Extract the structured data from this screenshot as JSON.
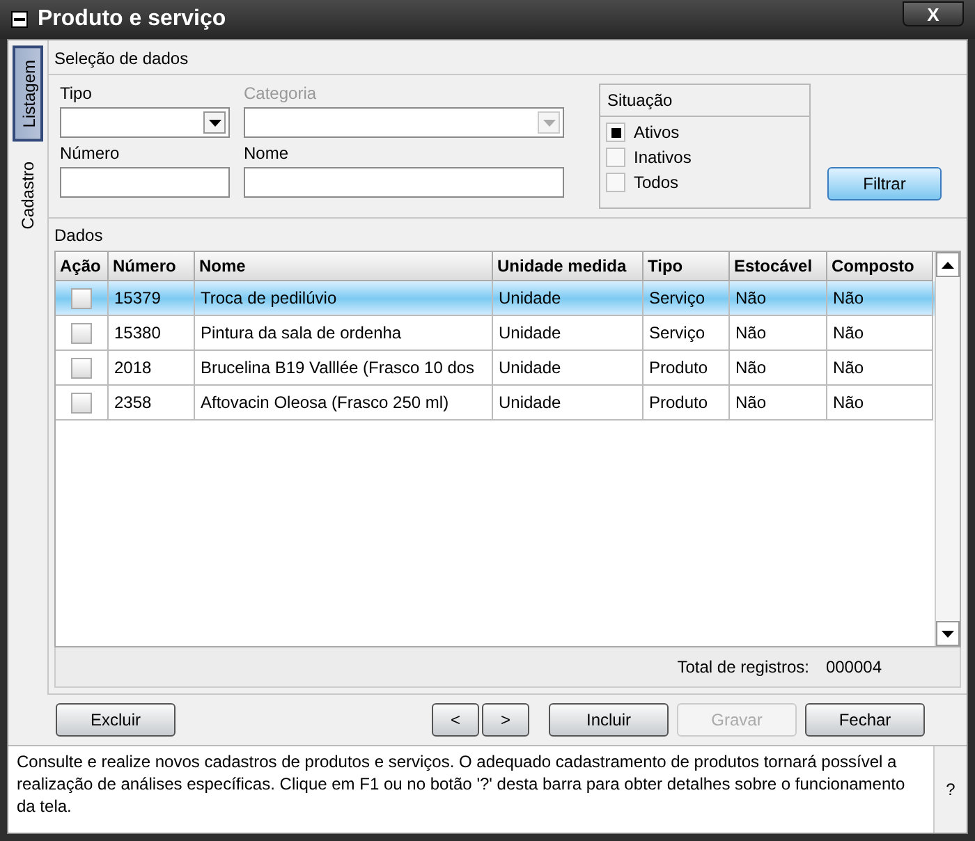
{
  "window": {
    "title": "Produto e serviço",
    "close": "X"
  },
  "side_tabs": [
    {
      "label": "Listagem",
      "selected": true
    },
    {
      "label": "Cadastro",
      "selected": false
    }
  ],
  "selection": {
    "title": "Seleção de dados",
    "fields": [
      {
        "label": "Tipo",
        "kind": "dropdown",
        "disabled": false
      },
      {
        "label": "Categoria",
        "kind": "dropdown",
        "disabled": true
      },
      {
        "label": "Número",
        "kind": "text",
        "disabled": false
      },
      {
        "label": "Nome",
        "kind": "text",
        "disabled": false
      }
    ],
    "situacao": {
      "title": "Situação",
      "options": [
        {
          "label": "Ativos",
          "selected": true
        },
        {
          "label": "Inativos",
          "selected": false
        },
        {
          "label": "Todos",
          "selected": false
        }
      ]
    },
    "filter_button": "Filtrar"
  },
  "data": {
    "title": "Dados",
    "columns": [
      "Ação",
      "Número",
      "Nome",
      "Unidade medida",
      "Tipo",
      "Estocável",
      "Composto"
    ],
    "rows": [
      {
        "checked": false,
        "selected": true,
        "cells": [
          "",
          "15379",
          "Troca de pedilúvio",
          "Unidade",
          "Serviço",
          "Não",
          "Não"
        ]
      },
      {
        "checked": false,
        "selected": false,
        "cells": [
          "",
          "15380",
          "Pintura da sala de ordenha",
          "Unidade",
          "Serviço",
          "Não",
          "Não"
        ]
      },
      {
        "checked": false,
        "selected": false,
        "cells": [
          "",
          "2018",
          "Brucelina B19 Valllée (Frasco 10 dos",
          "Unidade",
          "Produto",
          "Não",
          "Não"
        ]
      },
      {
        "checked": false,
        "selected": false,
        "cells": [
          "",
          "2358",
          "Aftovacin Oleosa (Frasco 250 ml)",
          "Unidade",
          "Produto",
          "Não",
          "Não"
        ]
      }
    ],
    "total_label": "Total de registros:",
    "total_value": "000004"
  },
  "buttons": [
    {
      "label": "Excluir",
      "disabled": false
    },
    {
      "label": "<",
      "disabled": false
    },
    {
      "label": ">",
      "disabled": false
    },
    {
      "label": "Incluir",
      "disabled": false
    },
    {
      "label": "Gravar",
      "disabled": true
    },
    {
      "label": "Fechar",
      "disabled": false
    }
  ],
  "help": {
    "text": "Consulte e realize novos cadastros de produtos e serviços. O adequado cadastramento de produtos tornará possível a realização de análises específicas. Clique em F1 ou no botão '?' desta barra para obter detalhes sobre o funcionamento da tela.",
    "button": "?"
  }
}
